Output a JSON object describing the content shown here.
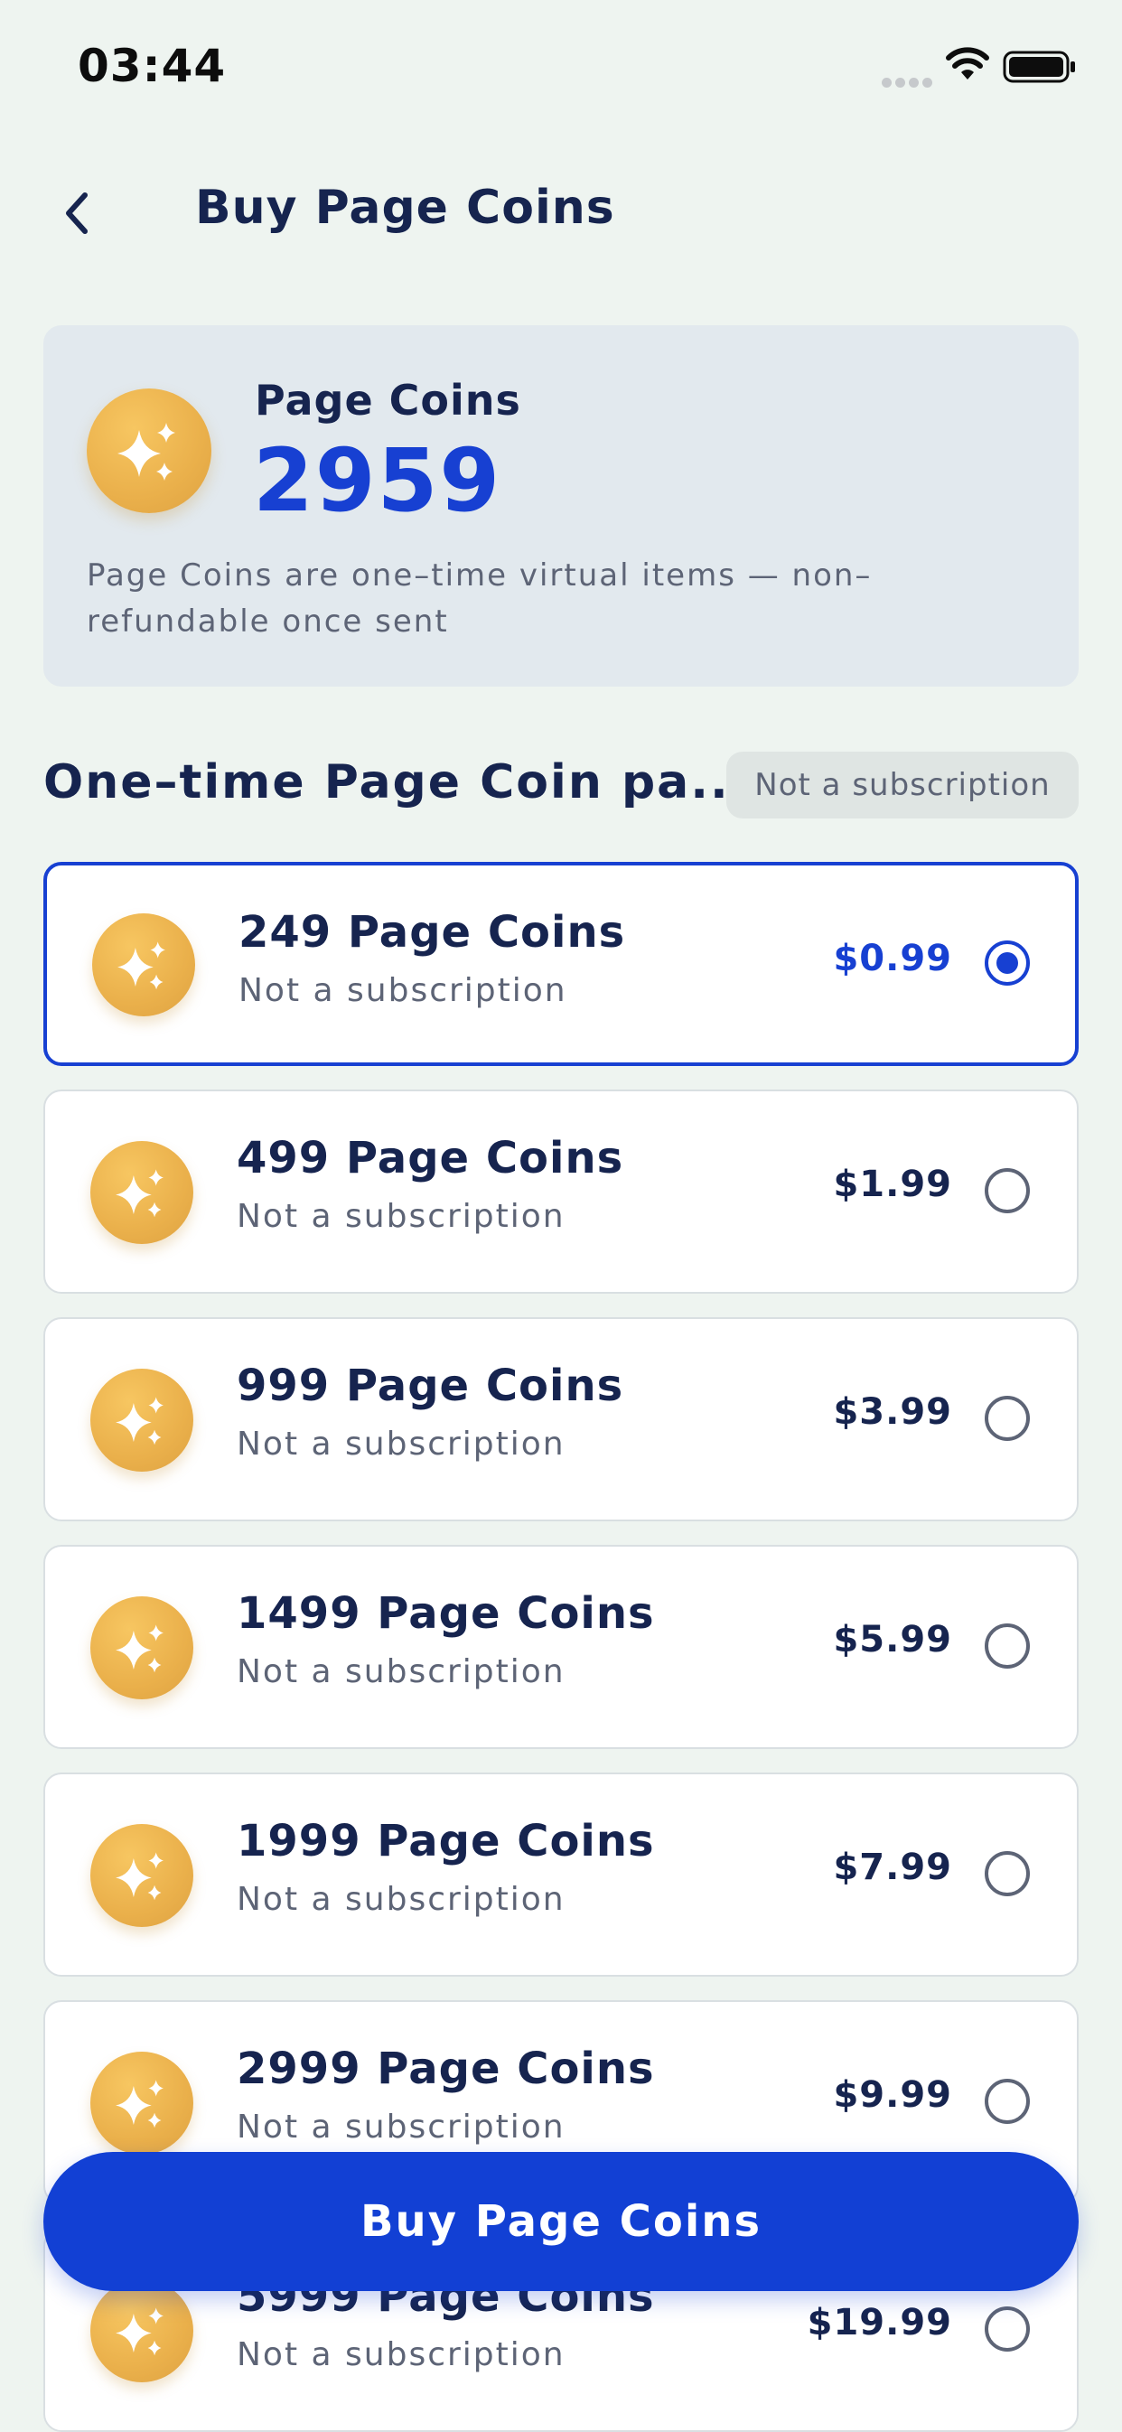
{
  "status_bar": {
    "time": "03:44"
  },
  "header": {
    "title": "Buy Page Coins"
  },
  "balance": {
    "label": "Page Coins",
    "value": "2959",
    "note": "Page Coins are one–time virtual items — non–refundable once sent"
  },
  "section": {
    "title": "One–time Page Coin pa...",
    "badge": "Not a subscription"
  },
  "packages": [
    {
      "title": "249 Page Coins",
      "subtitle": "Not a subscription",
      "price": "$0.99",
      "selected": true
    },
    {
      "title": "499 Page Coins",
      "subtitle": "Not a subscription",
      "price": "$1.99",
      "selected": false
    },
    {
      "title": "999 Page Coins",
      "subtitle": "Not a subscription",
      "price": "$3.99",
      "selected": false
    },
    {
      "title": "1499 Page Coins",
      "subtitle": "Not a subscription",
      "price": "$5.99",
      "selected": false
    },
    {
      "title": "1999 Page Coins",
      "subtitle": "Not a subscription",
      "price": "$7.99",
      "selected": false
    },
    {
      "title": "2999 Page Coins",
      "subtitle": "Not a subscription",
      "price": "$9.99",
      "selected": false
    },
    {
      "title": "5999 Page Coins",
      "subtitle": "Not a subscription",
      "price": "$19.99",
      "selected": false
    }
  ],
  "buy_button": {
    "label": "Buy Page Coins"
  },
  "icons": {
    "back": "chevron-left-icon",
    "coin": "sparkle-coin-icon",
    "wifi": "wifi-icon",
    "battery": "battery-icon",
    "signal": "signal-dots-icon"
  },
  "colors": {
    "accent": "#1740d2",
    "background": "#eef4f0",
    "text_primary": "#16244f",
    "text_secondary": "#5d6476",
    "coin_gold": "#eab04b",
    "card_background": "#e2e9ee"
  }
}
